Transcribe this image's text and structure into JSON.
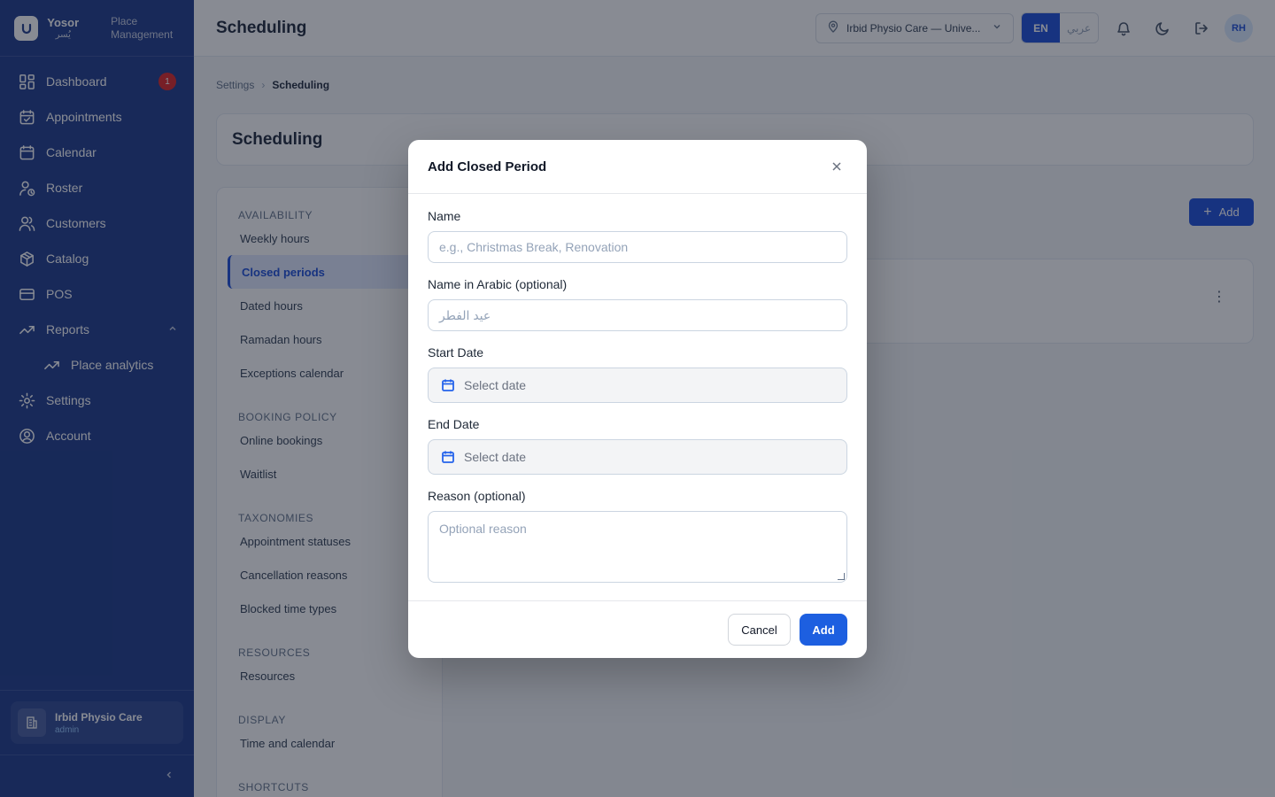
{
  "brand": {
    "name": "Yosor",
    "name_ar": "يُسر",
    "subtitle": "Place Management"
  },
  "sidebar": {
    "items": [
      {
        "label": "Dashboard",
        "badge": "1"
      },
      {
        "label": "Appointments"
      },
      {
        "label": "Calendar"
      },
      {
        "label": "Roster"
      },
      {
        "label": "Customers"
      },
      {
        "label": "Catalog"
      },
      {
        "label": "POS"
      },
      {
        "label": "Reports"
      },
      {
        "label": "Place analytics"
      },
      {
        "label": "Settings"
      },
      {
        "label": "Account"
      }
    ],
    "footer": {
      "place_name": "Irbid Physio Care",
      "role": "admin"
    }
  },
  "topbar": {
    "title": "Scheduling",
    "location": "Irbid Physio Care — Unive...",
    "lang_en": "EN",
    "lang_ar": "عربي",
    "avatar_initials": "RH"
  },
  "breadcrumb": {
    "parent": "Settings",
    "current": "Scheduling"
  },
  "page": {
    "title": "Scheduling",
    "add_label": "Add"
  },
  "settings_nav": {
    "sections": [
      {
        "heading": "AVAILABILITY",
        "items": [
          "Weekly hours",
          "Closed periods",
          "Dated hours",
          "Ramadan hours",
          "Exceptions calendar"
        ]
      },
      {
        "heading": "BOOKING POLICY",
        "items": [
          "Online bookings",
          "Waitlist"
        ]
      },
      {
        "heading": "TAXONOMIES",
        "items": [
          "Appointment statuses",
          "Cancellation reasons",
          "Blocked time types"
        ]
      },
      {
        "heading": "RESOURCES",
        "items": [
          "Resources"
        ]
      },
      {
        "heading": "DISPLAY",
        "items": [
          "Time and calendar"
        ]
      },
      {
        "heading": "SHORTCUTS",
        "items": []
      }
    ],
    "active": "Closed periods"
  },
  "modal": {
    "title": "Add Closed Period",
    "name_label": "Name",
    "name_placeholder": "e.g., Christmas Break, Renovation",
    "name_ar_label": "Name in Arabic (optional)",
    "name_ar_placeholder": "عيد الفطر",
    "start_label": "Start Date",
    "start_placeholder": "Select date",
    "end_label": "End Date",
    "end_placeholder": "Select date",
    "reason_label": "Reason (optional)",
    "reason_placeholder": "Optional reason",
    "cancel_label": "Cancel",
    "add_label": "Add"
  },
  "colors": {
    "sidebar": "#1e3a8a",
    "accent": "#1d4ed8",
    "badge": "#dc2626"
  }
}
